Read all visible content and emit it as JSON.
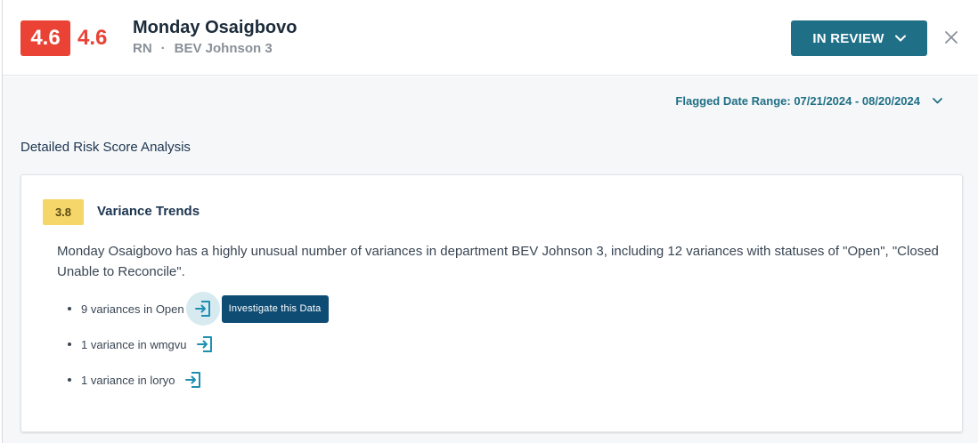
{
  "header": {
    "score_badge": "4.6",
    "score_text": "4.6",
    "name": "Monday Osaigbovo",
    "role": "RN",
    "separator": "·",
    "department": "BEV Johnson 3",
    "status_button_label": "IN REVIEW"
  },
  "filters": {
    "date_range_label": "Flagged Date Range: 07/21/2024 - 08/20/2024"
  },
  "section_title": "Detailed Risk Score Analysis",
  "card": {
    "score": "3.8",
    "title": "Variance Trends",
    "description": "Monday Osaigbovo has a highly unusual number of variances in department BEV Johnson 3, including 12 variances with statuses of \"Open\", \"Closed Unable to Reconcile\".",
    "items": [
      {
        "label": "9 variances in Open"
      },
      {
        "label": "1 variance in wmgvu"
      },
      {
        "label": "1 variance in loryo"
      }
    ],
    "tooltip": "Investigate this Data"
  },
  "colors": {
    "score_red": "#ea4234",
    "teal": "#1f6f86",
    "chip_yellow": "#f4d66a",
    "tooltip_navy": "#0f4c73"
  },
  "icons": {
    "close": "close-icon",
    "dropdown": "chevron-down-icon",
    "investigate": "enter-arrow-icon"
  }
}
